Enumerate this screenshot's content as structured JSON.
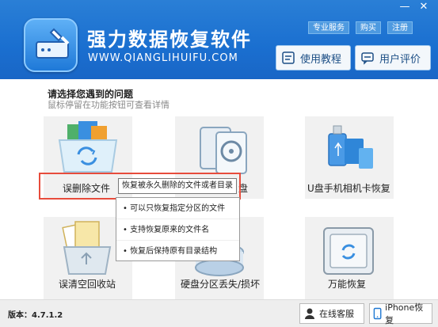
{
  "app": {
    "title": "强力数据恢复软件",
    "url": "WWW.QIANGLIHUIFU.COM"
  },
  "window_controls": {
    "minimize": "—",
    "close": "✕"
  },
  "top_links": [
    "专业服务",
    "购买",
    "注册"
  ],
  "header_buttons": {
    "tutorial": "使用教程",
    "review": "用户评价"
  },
  "prompt": {
    "title": "请选择您遇到的问题",
    "subtitle": "鼠标停留在功能按钮可查看详情"
  },
  "tiles": [
    {
      "label": "误删除文件",
      "icon": "recycle-files-icon"
    },
    {
      "label": "盘",
      "icon": "hard-disk-icon"
    },
    {
      "label": "U盘手机相机卡恢复",
      "icon": "usb-sdcard-icon"
    },
    {
      "label": "误清空回收站",
      "icon": "recycle-bin-icon"
    },
    {
      "label": "硬盘分区丢失/损坏",
      "icon": "disk-partition-icon"
    },
    {
      "label": "万能恢复",
      "icon": "safe-box-icon"
    }
  ],
  "tooltip": {
    "main": "恢复被永久删除的文件或者目录",
    "items": [
      "• 可以只恢复指定分区的文件",
      "• 支持恢复原来的文件名",
      "• 恢复后保持原有目录结构"
    ]
  },
  "footer": {
    "version": "版本：4.7.1.2",
    "online_service": "在线客服",
    "iphone_recovery": "iPhone恢复"
  },
  "colors": {
    "header": "#1a6fd0",
    "highlight": "#e74c3c"
  }
}
